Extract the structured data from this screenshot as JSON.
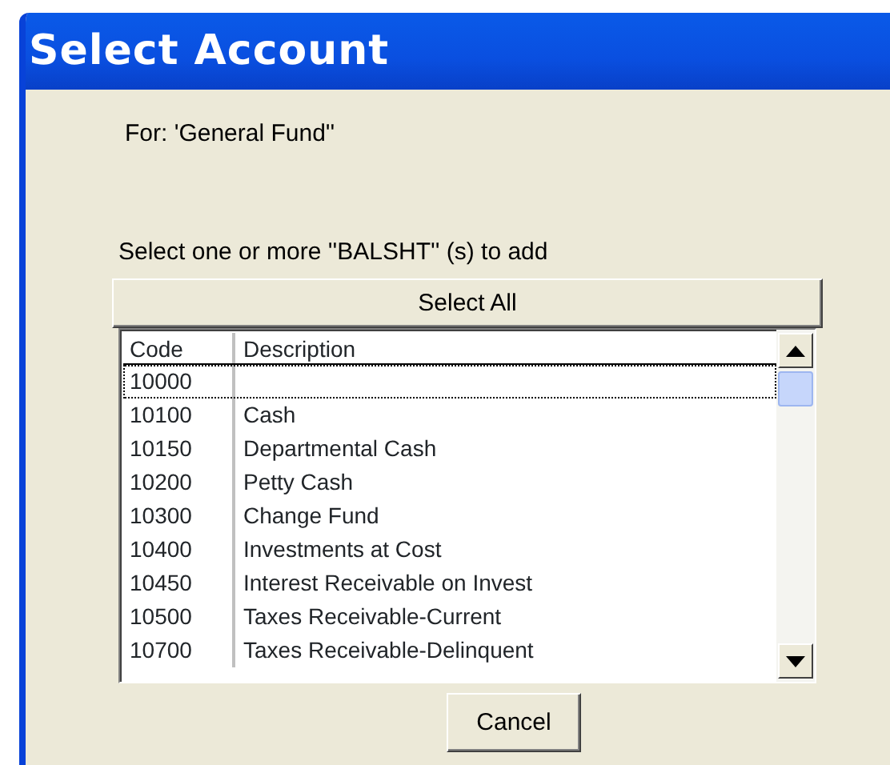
{
  "window": {
    "title": "Select Account"
  },
  "for_label": "For: 'General Fund''",
  "instruction": "Select one or more ''BALSHT'' (s) to add",
  "select_all_button": "Select All",
  "list": {
    "columns": [
      "Code",
      "Description"
    ],
    "rows": [
      {
        "code": "10000",
        "description": "",
        "focused": true
      },
      {
        "code": "10100",
        "description": "Cash",
        "focused": false
      },
      {
        "code": "10150",
        "description": "Departmental Cash",
        "focused": false
      },
      {
        "code": "10200",
        "description": "Petty Cash",
        "focused": false
      },
      {
        "code": "10300",
        "description": "Change Fund",
        "focused": false
      },
      {
        "code": "10400",
        "description": "Investments at Cost",
        "focused": false
      },
      {
        "code": "10450",
        "description": "Interest Receivable on Invest",
        "focused": false
      },
      {
        "code": "10500",
        "description": "Taxes Receivable-Current",
        "focused": false
      },
      {
        "code": "10700",
        "description": "Taxes Receivable-Delinquent",
        "focused": false
      }
    ]
  },
  "buttons": [
    "Cancel"
  ]
}
